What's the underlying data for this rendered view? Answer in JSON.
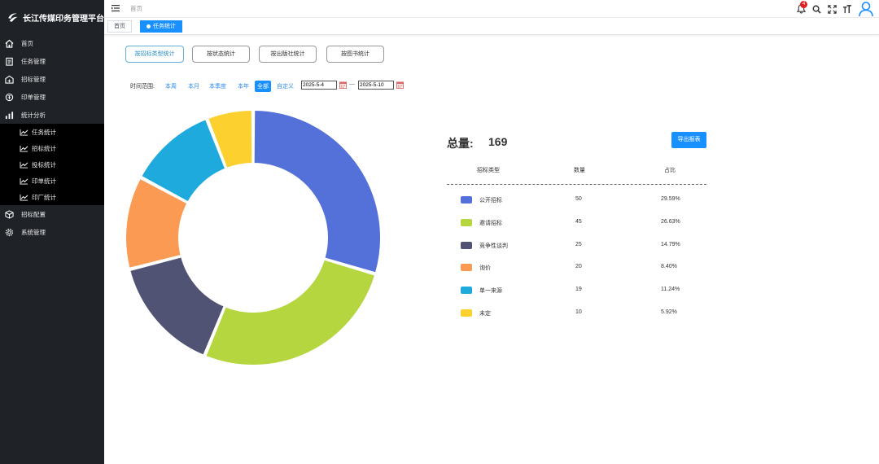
{
  "app": {
    "title": "长江传媒印务管理平台"
  },
  "sidebar": {
    "items": [
      {
        "label": "首页",
        "icon": "home-icon"
      },
      {
        "label": "任务管理",
        "icon": "clipboard-icon"
      },
      {
        "label": "招标管理",
        "icon": "bidding-icon"
      },
      {
        "label": "印单管理",
        "icon": "print-order-icon"
      },
      {
        "label": "统计分析",
        "icon": "statistics-icon"
      }
    ],
    "subitems": [
      {
        "label": "任务统计",
        "icon": "trend-chart-icon"
      },
      {
        "label": "招标统计",
        "icon": "trend-chart-icon"
      },
      {
        "label": "投标统计",
        "icon": "trend-chart-icon"
      },
      {
        "label": "印单统计",
        "icon": "trend-chart-icon"
      },
      {
        "label": "印厂统计",
        "icon": "trend-chart-icon"
      }
    ],
    "items_after": [
      {
        "label": "招标配置",
        "icon": "cube-icon"
      },
      {
        "label": "系统管理",
        "icon": "gear-icon"
      }
    ]
  },
  "topbar": {
    "breadcrumb": "首页",
    "notification_count": "4"
  },
  "tags": [
    {
      "label": "首页"
    },
    {
      "label": "任务统计"
    }
  ],
  "stat_tabs": [
    {
      "label": "按招标类型统计"
    },
    {
      "label": "按状态统计"
    },
    {
      "label": "按出版社统计"
    },
    {
      "label": "按图书统计"
    }
  ],
  "time_range": {
    "label": "时间范围:",
    "options": [
      "本周",
      "本月",
      "本季度",
      "本年",
      "全部",
      "自定义"
    ],
    "selected": "全部",
    "start_date": "2025-5-4",
    "separator": "—",
    "end_date": "2025-5-10"
  },
  "summary": {
    "total_label": "总量:",
    "total_value": "169",
    "export_label": "导出报表"
  },
  "table": {
    "headers": [
      "招标类型",
      "数量",
      "占比"
    ]
  },
  "chart_data": {
    "type": "pie",
    "donut": true,
    "series": [
      {
        "name": "公开招标",
        "value": 50,
        "percent": "29.59%",
        "color": "#5470d9"
      },
      {
        "name": "邀请招标",
        "value": 45,
        "percent": "26.63%",
        "color": "#b5d63e"
      },
      {
        "name": "竞争性谈判",
        "value": 25,
        "percent": "14.79%",
        "color": "#505373"
      },
      {
        "name": "询价",
        "value": 20,
        "percent": "8.40%",
        "color": "#fb9a52"
      },
      {
        "name": "单一来源",
        "value": 19,
        "percent": "11.24%",
        "color": "#1eaadc"
      },
      {
        "name": "未定",
        "value": 10,
        "percent": "5.92%",
        "color": "#fcd02e"
      }
    ]
  }
}
